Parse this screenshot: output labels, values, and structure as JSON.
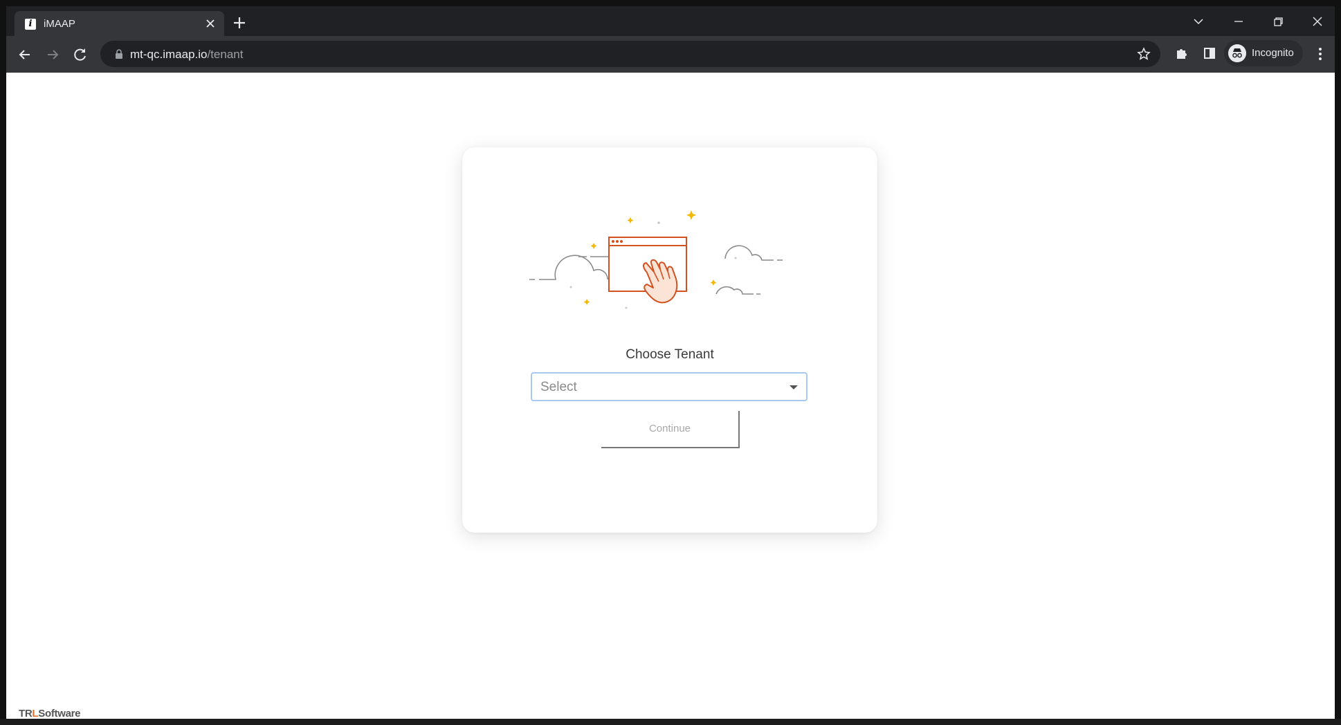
{
  "browser": {
    "tab": {
      "title": "iMAAP",
      "favicon_letter": "i",
      "close_icon": "close-icon"
    },
    "new_tab_icon": "plus-icon",
    "window_controls": [
      "chevron-down-icon",
      "minimize-icon",
      "restore-icon",
      "close-icon"
    ],
    "url": {
      "host": "mt-qc.imaap.io",
      "path": "/tenant"
    },
    "profile_label": "Incognito"
  },
  "page": {
    "title": "Choose Tenant",
    "select": {
      "placeholder": "Select"
    },
    "continue_label": "Continue",
    "footer": {
      "brand_part1": "TR",
      "brand_part2": "L",
      "brand_part3": "Software"
    }
  },
  "colors": {
    "accent": "#d4501f",
    "sparkle": "#f5b800",
    "select_border": "#a8c8ef"
  }
}
